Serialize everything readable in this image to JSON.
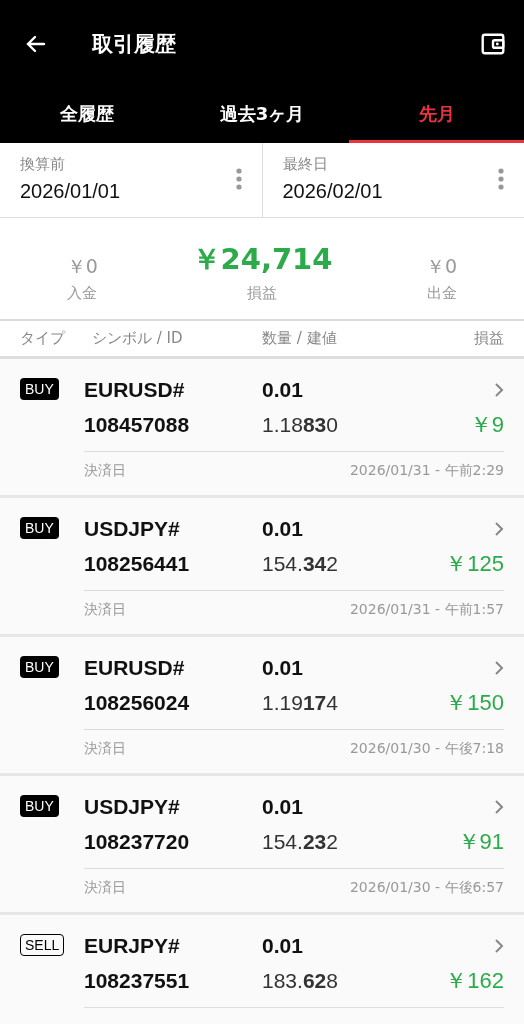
{
  "header": {
    "title": "取引履歴"
  },
  "tabs": [
    {
      "label": "全履歴",
      "selected": false
    },
    {
      "label": "過去3ヶ月",
      "selected": false
    },
    {
      "label": "先月",
      "selected": true
    }
  ],
  "date_range": [
    {
      "label": "換算前",
      "value": "2026/01/01"
    },
    {
      "label": "最終日",
      "value": "2026/02/01"
    }
  ],
  "summary": [
    {
      "value": "￥0",
      "label": "入金",
      "main": false
    },
    {
      "value": "￥24,714",
      "label": "損益",
      "main": true
    },
    {
      "value": "￥0",
      "label": "出金",
      "main": false
    }
  ],
  "columns": [
    "タイプ",
    "シンボル / ID",
    "数量 / 建値",
    "損益"
  ],
  "trades": [
    {
      "kind": "buy",
      "type": "BUY",
      "symbol": "EURUSD#",
      "id": "108457088",
      "volume": "0.01",
      "price": "1.18**83**0",
      "profit": "￥9",
      "date_label": "決済日",
      "date": "2026/01/31 - 午前2:29"
    },
    {
      "kind": "buy",
      "type": "BUY",
      "symbol": "USDJPY#",
      "id": "108256441",
      "volume": "0.01",
      "price": "154.**34**2",
      "profit": "￥125",
      "date_label": "決済日",
      "date": "2026/01/31 - 午前1:57"
    },
    {
      "kind": "buy",
      "type": "BUY",
      "symbol": "EURUSD#",
      "id": "108256024",
      "volume": "0.01",
      "price": "1.19**17**4",
      "profit": "￥150",
      "date_label": "決済日",
      "date": "2026/01/30 - 午後7:18"
    },
    {
      "kind": "buy",
      "type": "BUY",
      "symbol": "USDJPY#",
      "id": "108237720",
      "volume": "0.01",
      "price": "154.**23**2",
      "profit": "￥91",
      "date_label": "決済日",
      "date": "2026/01/30 - 午後6:57"
    },
    {
      "kind": "sell",
      "type": "SELL",
      "symbol": "EURJPY#",
      "id": "108237551",
      "volume": "0.01",
      "price": "183.**62**8",
      "profit": "￥162"
    }
  ]
}
